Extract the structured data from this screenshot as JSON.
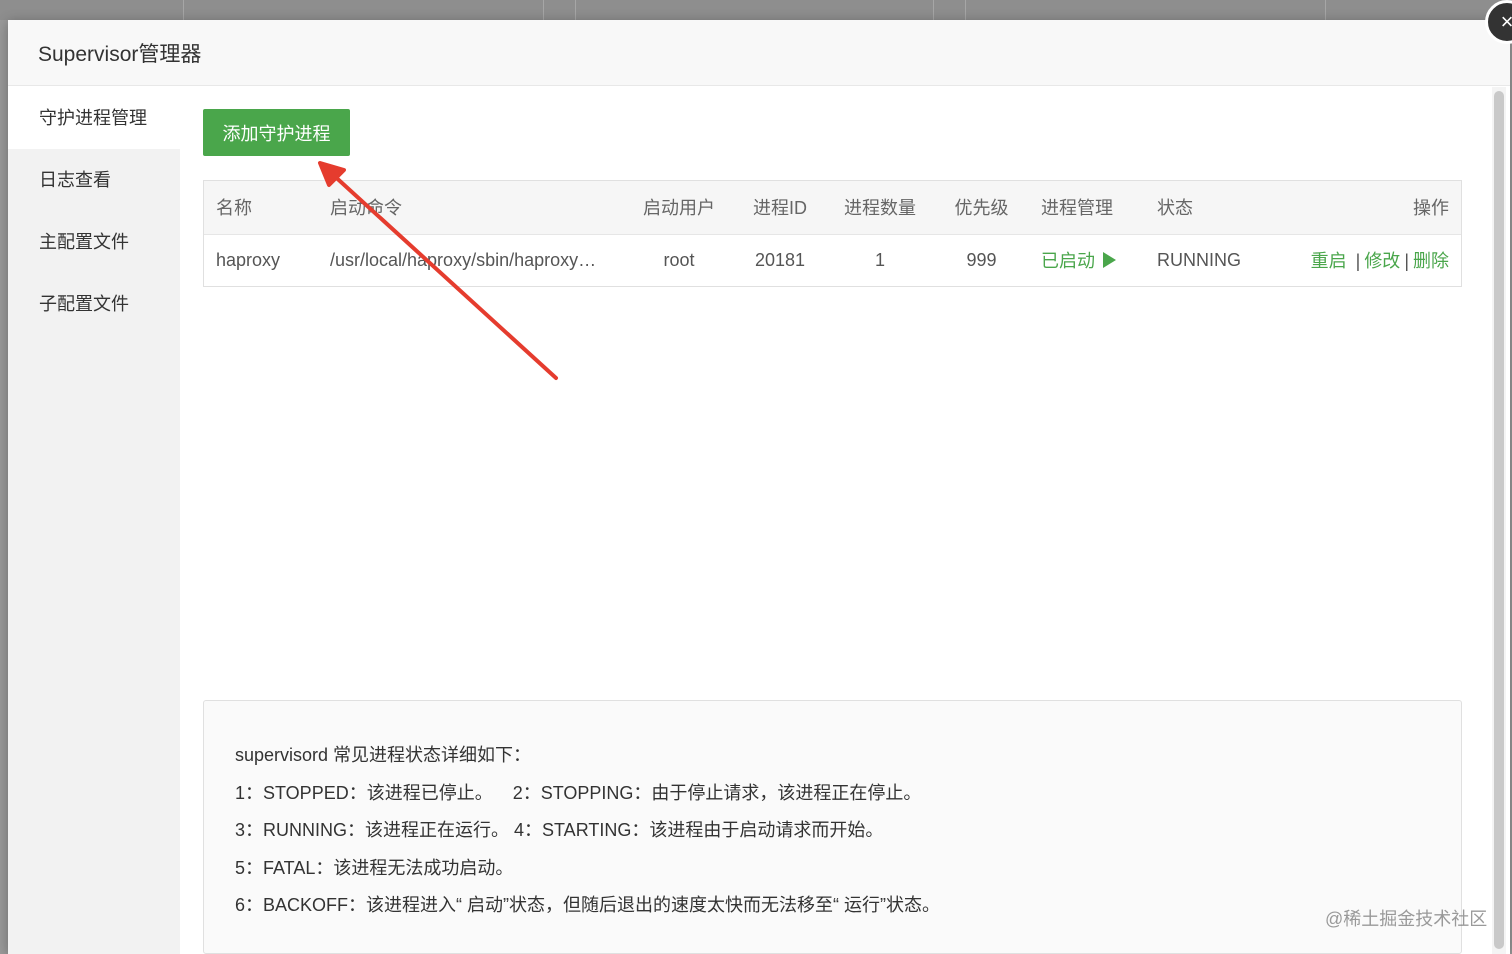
{
  "modal": {
    "title": "Supervisor管理器",
    "close_glyph": "×"
  },
  "sidebar": {
    "items": [
      {
        "label": "守护进程管理",
        "active": true
      },
      {
        "label": "日志查看",
        "active": false
      },
      {
        "label": "主配置文件",
        "active": false
      },
      {
        "label": "子配置文件",
        "active": false
      }
    ]
  },
  "toolbar": {
    "add_label": "添加守护进程"
  },
  "table": {
    "headers": {
      "name": "名称",
      "command": "启动命令",
      "user": "启动用户",
      "pid": "进程ID",
      "count": "进程数量",
      "priority": "优先级",
      "manage": "进程管理",
      "status": "状态",
      "actions": "操作"
    },
    "rows": [
      {
        "name": "haproxy",
        "command": "/usr/local/haproxy/sbin/haproxy…",
        "user": "root",
        "pid": "20181",
        "count": "1",
        "priority": "999",
        "manage": "已启动",
        "status": "RUNNING",
        "action_restart": "重启",
        "action_edit": "修改",
        "action_delete": "删除",
        "separator": "|"
      }
    ]
  },
  "info": {
    "lines": [
      "supervisord 常见进程状态详细如下：",
      "1：STOPPED：该进程已停止。    2：STOPPING：由于停止请求，该进程正在停止。",
      "3：RUNNING：该进程正在运行。 4：STARTING：该进程由于启动请求而开始。",
      "5：FATAL：该进程无法成功启动。",
      "6：BACKOFF：该进程进入“ 启动”状态，但随后退出的速度太快而无法移至“ 运行”状态。"
    ]
  },
  "watermark": "@稀土掘金技术社区",
  "colors": {
    "accent": "#4aa64b",
    "annotation_arrow": "#e53c2e"
  }
}
